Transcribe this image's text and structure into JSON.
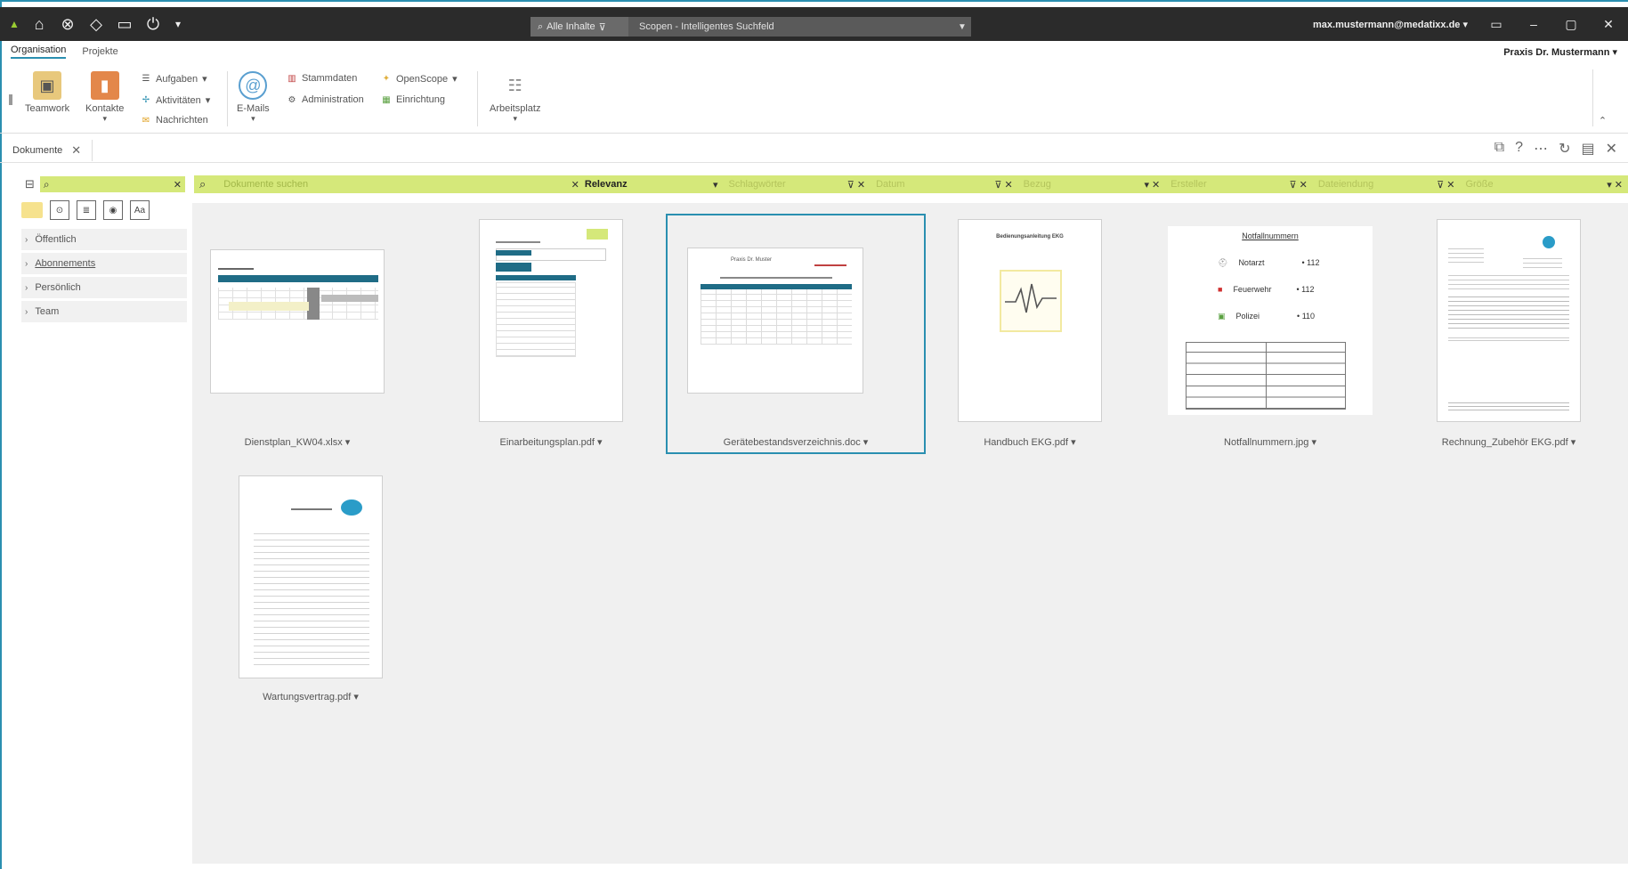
{
  "titlebar": {
    "scope_label": "Alle Inhalte",
    "search_text": "Scopen - Intelligentes Suchfeld",
    "user": "max.mustermann@medatixx.de",
    "minimize": "–",
    "maximize": "▢",
    "close": "✕"
  },
  "ribbon": {
    "tabs": [
      "Organisation",
      "Projekte"
    ],
    "practice": "Praxis Dr. Mustermann",
    "teamwork": "Teamwork",
    "kontakte": "Kontakte",
    "aufgaben": "Aufgaben",
    "aktivitaeten": "Aktivitäten",
    "nachrichten": "Nachrichten",
    "email": "E-Mails",
    "stammdaten": "Stammdaten",
    "administration": "Administration",
    "openscope": "OpenScope",
    "einrichtung": "Einrichtung",
    "arbeitsplatz": "Arbeitsplatz"
  },
  "doctab": {
    "label": "Dokumente",
    "close": "✕"
  },
  "filterbar": {
    "search_placeholder": "Dokumente suchen",
    "relevance": "Relevanz",
    "schlagwoerter": "Schlagwörter",
    "datum": "Datum",
    "bezug": "Bezug",
    "ersteller": "Ersteller",
    "dateiendung": "Dateiendung",
    "groesse": "Größe"
  },
  "sidebar": {
    "items": [
      {
        "label": "Öffentlich"
      },
      {
        "label": "Abonnements"
      },
      {
        "label": "Persönlich"
      },
      {
        "label": "Team"
      }
    ]
  },
  "documents": [
    {
      "name": "Dienstplan_KW04.xlsx"
    },
    {
      "name": "Einarbeitungsplan.pdf"
    },
    {
      "name": "Gerätebestandsverzeichnis.doc"
    },
    {
      "name": "Handbuch EKG.pdf"
    },
    {
      "name": "Notfallnummern.jpg"
    },
    {
      "name": "Rechnung_Zubehör EKG.pdf"
    },
    {
      "name": "Wartungsvertrag.pdf"
    }
  ],
  "notfall": {
    "title": "Notfallnummern",
    "rows": [
      {
        "label": "Notarzt",
        "number": "112"
      },
      {
        "label": "Feuerwehr",
        "number": "112"
      },
      {
        "label": "Polizei",
        "number": "110"
      }
    ]
  },
  "handbuch": {
    "title": "Bedienungsanleitung EKG"
  },
  "geraete": {
    "title": "Praxis Dr. Muster"
  },
  "colors": {
    "accent": "#2a8fb0",
    "filter": "#d5e87a",
    "titlebar": "#2b2b2b"
  }
}
